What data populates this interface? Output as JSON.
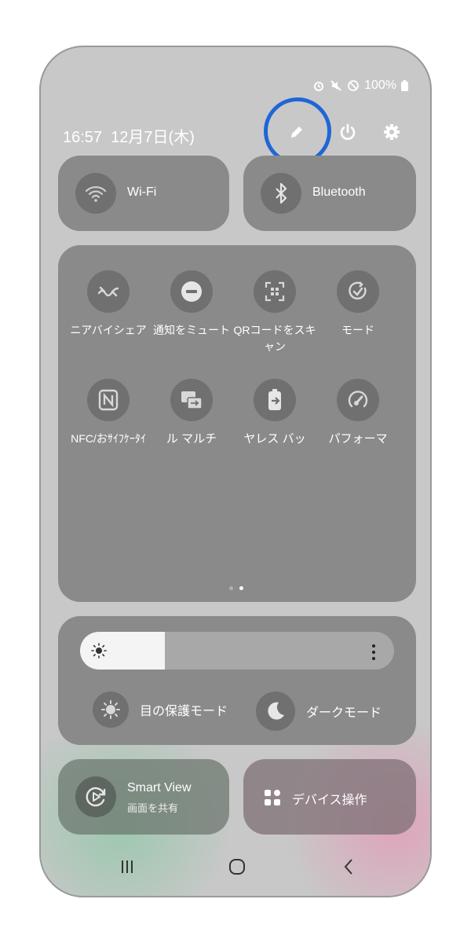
{
  "status": {
    "battery": "100%"
  },
  "header": {
    "time": "16:57",
    "date": "12月7日(木)"
  },
  "top_tiles": [
    {
      "label": "Wi-Fi",
      "icon": "wifi-icon"
    },
    {
      "label": "Bluetooth",
      "icon": "bluetooth-icon"
    }
  ],
  "quick_settings": {
    "row1": [
      {
        "label": "ニアバイシェア",
        "icon": "nearby-share-icon"
      },
      {
        "label": "通知をミュート",
        "icon": "mute-notifications-icon"
      },
      {
        "label": "QRコードをスキャン",
        "icon": "qr-scan-icon"
      },
      {
        "label": "モード",
        "icon": "modes-icon"
      }
    ],
    "row2": [
      {
        "label": "NFC/おｻｲﾌｹｰﾀｲ",
        "icon": "nfc-icon"
      },
      {
        "label": "ル マルチ",
        "icon": "multi-control-icon"
      },
      {
        "label": "ヤレス バッ",
        "icon": "wireless-battery-icon"
      },
      {
        "label": "パフォーマ",
        "icon": "performance-icon"
      }
    ],
    "page_count": 2,
    "active_page": 2
  },
  "brightness": {
    "level_fraction": 0.27,
    "eye_comfort_label": "目の保護モード",
    "dark_mode_label": "ダークモード"
  },
  "bottom_tiles": {
    "smart_view_title": "Smart View",
    "smart_view_sub": "画面を共有",
    "device_control_label": "デバイス操作"
  },
  "colors": {
    "highlight_ring": "#1f66d6",
    "tile_bg": "#8a8a8a",
    "icon_circle": "#707070"
  }
}
